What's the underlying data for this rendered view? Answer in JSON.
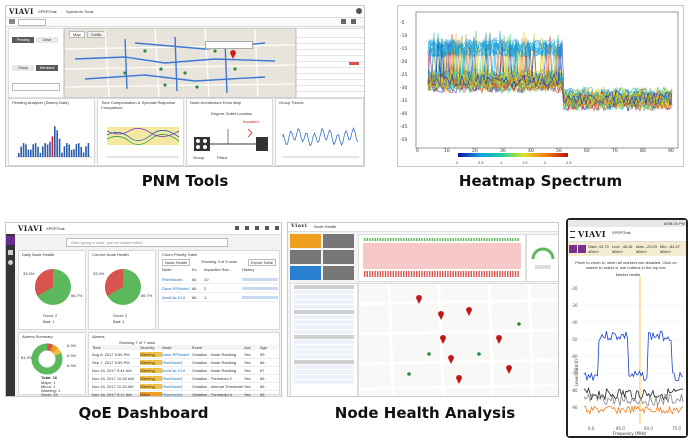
{
  "captions": {
    "pnm": "PNM Tools",
    "heatmap": "Heatmap Spectrum",
    "qoe": "QoE Dashboard",
    "node": "Node Health Analysis"
  },
  "pnm": {
    "logo": "VIAVI",
    "product": "XPERTrak",
    "subtitle": "Spectrum Tools",
    "tabs": [
      "Map",
      "Traffic"
    ],
    "buttons": [
      "Pending",
      "Clear",
      "Group",
      "Members"
    ],
    "panels": [
      "Pending Analyzer (Sweep Data)",
      "Time Compensation & Spectral Response Comparison",
      "Node Architecture Echo Map",
      "Group Trends"
    ],
    "ofdm_label": "Degree Outlet Location",
    "ofdm_value": "Impaired",
    "legend_top": "Group",
    "legend_bottom": "Fitted"
  },
  "qoe": {
    "logo": "VIAVI",
    "product": "XPERTrak",
    "search_placeholder": "Start typing a node, port or modem MAC",
    "cards": [
      "Daily Node Health",
      "Current Node Health",
      "Churn Priority Table",
      "Alarms Summary",
      "Alarms"
    ],
    "pie1": {
      "bad_pct": "33.3%",
      "good_pct": "66.7%",
      "good_label": "Good: 2",
      "bad_label": "Bad: 1"
    },
    "pie2": {
      "bad_pct": "33.3%",
      "good_pct": "66.7%",
      "good_label": "Good: 2",
      "bad_label": "Bad: 1"
    },
    "churn_filter": "Node Health",
    "churn_showing": "Showing 3 of 3 rows",
    "export": "Export Table",
    "churn_columns": [
      "Node",
      "Ex",
      "Impacted Sub...",
      "History"
    ],
    "churn_rows": [
      {
        "node": "FiberNode1",
        "ex": "66",
        "sub": "10"
      },
      {
        "node": "Dave-RFNode1",
        "ex": "66",
        "sub": "2"
      },
      {
        "node": "AnxtCal-10-6",
        "ex": "66",
        "sub": "1"
      }
    ],
    "alarm_summary": {
      "total": "Total: 16",
      "major": "Major: 1",
      "minor": "Minor: 1",
      "warning": "Warning: 1",
      "good": "Good: 13",
      "p1": "6.3%",
      "p2": "81.3%",
      "p3": "6.3%",
      "p4": "6.3%"
    },
    "alarm_showing": "Showing 7 of 7 rows",
    "alarm_columns": [
      "Time",
      "Severity",
      "Node",
      "Event",
      "Ack",
      "Age"
    ],
    "alarm_rows": [
      {
        "time": "Aug 8, 2017 5:56 PM",
        "sev": "Warning",
        "node": "Dave-RFNode1",
        "event": "Violation - Node Ranking",
        "ack": "Yes",
        "age": "99"
      },
      {
        "time": "Sep 7, 2017 5:59 PM",
        "sev": "Warning",
        "node": "FiberNode1",
        "event": "Violation - Node Ranking",
        "ack": "Yes",
        "age": "66"
      },
      {
        "time": "Nov 15, 2017 9:41 AM",
        "sev": "Warning",
        "node": "AnxtCal-10-6",
        "event": "Violation - Node Ranking",
        "ack": "Yes",
        "age": "67"
      },
      {
        "time": "Nov 15, 2017 10:42 AM",
        "sev": "Warning",
        "node": "FiberNode1",
        "event": "Violation - Threshold 2",
        "ack": "Yes",
        "age": "65"
      },
      {
        "time": "Nov 15, 2017 11:15 AM",
        "sev": "Warning",
        "node": "FiberNode1",
        "event": "Violation - Interval Threshold",
        "ack": "Yes",
        "age": "65"
      },
      {
        "time": "Nov 16, 2017 5:17 AM",
        "sev": "Major",
        "node": "FiberNode1",
        "event": "Violation - Threshold 4",
        "ack": "Yes",
        "age": "65"
      }
    ]
  },
  "node": {
    "logo": "Viavi",
    "header": "Node Health"
  },
  "mobile": {
    "logo": "VIAVI",
    "product": "XPERTrak",
    "status_time": "2:25 PM",
    "status_battery": "65%",
    "boxes": [
      "Start: 43.75 dBmV",
      "Live: -46.81 dBmV",
      "Max: -23.09 dBmV",
      "Min: -84.07 dBmV"
    ],
    "hint": "Pinch to zoom in, when all markers are disabled. Click on marker to select or use buttons in the top nav.",
    "marker_title": "Marker health",
    "ylabel": "Level (dBmV)",
    "xlabel": "Frequency (MHz)",
    "xticks": [
      "0.0",
      "85.0",
      "60.0",
      "75.0"
    ],
    "yticks": [
      "-20",
      "-30",
      "-40",
      "-50",
      "-60",
      "-70",
      "-80",
      "-90"
    ]
  },
  "heatmap": {
    "yticks": [
      "-5",
      "-10",
      "-15",
      "-20",
      "-25",
      "-30",
      "-35",
      "-40",
      "-45",
      "-50"
    ],
    "xticks": [
      "0",
      "10",
      "20",
      "30",
      "40",
      "50",
      "60",
      "70",
      "80",
      "90"
    ],
    "colorbar_ticks": [
      "0",
      "0.5",
      "1",
      "1.5",
      "2",
      "2.5"
    ]
  },
  "colors": {
    "viavi_purple": "#6b2c91",
    "healthy_green": "#5cb85c",
    "bad_red": "#d9534f",
    "warning_yellow": "#f0c040",
    "major_orange": "#f0a020",
    "mobile_purple": "#7a2f8f"
  }
}
